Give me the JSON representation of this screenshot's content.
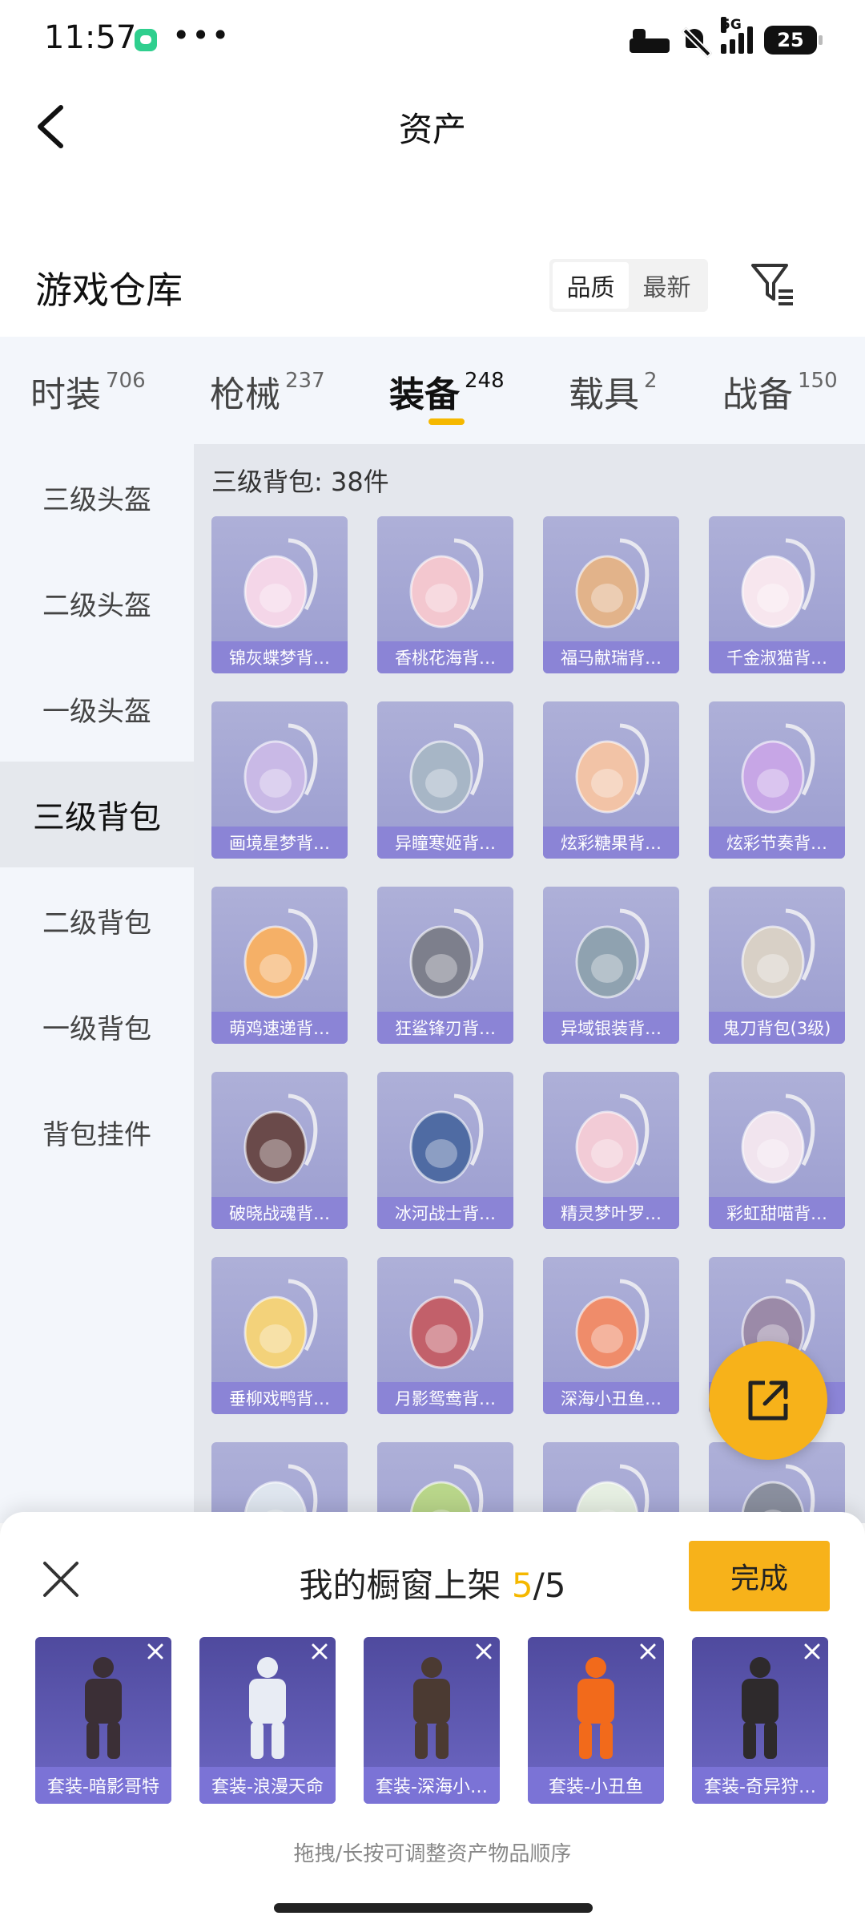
{
  "status_bar": {
    "time": "11:57",
    "more": "•••",
    "network": "5G",
    "battery": "25",
    "icons": [
      "chat-app-icon",
      "bed-icon",
      "mute-icon",
      "signal-icon",
      "battery-icon"
    ]
  },
  "header": {
    "title": "资产",
    "back_icon": "chevron-left-icon"
  },
  "section": {
    "title": "游戏仓库"
  },
  "sort": {
    "options": [
      "品质",
      "最新"
    ],
    "selected": "品质"
  },
  "filter": {
    "icon": "filter-icon"
  },
  "tabs": [
    {
      "label": "时装",
      "count": "706"
    },
    {
      "label": "枪械",
      "count": "237"
    },
    {
      "label": "装备",
      "count": "248"
    },
    {
      "label": "载具",
      "count": "2"
    },
    {
      "label": "战备",
      "count": "150"
    }
  ],
  "active_tab": "装备",
  "sidebar": {
    "items": [
      "三级头盔",
      "二级头盔",
      "一级头盔",
      "三级背包",
      "二级背包",
      "一级背包",
      "背包挂件"
    ],
    "active": "三级背包"
  },
  "main": {
    "heading": "三级背包: 38件",
    "items": [
      "锦灰蝶梦背…",
      "香桃花海背…",
      "福马献瑞背…",
      "千金淑猫背…",
      "画境星梦背…",
      "异瞳寒姬背…",
      "炫彩糖果背…",
      "炫彩节奏背…",
      "萌鸡速递背…",
      "狂鲨锋刃背…",
      "异域银装背…",
      "鬼刀背包(3级)",
      "破晓战魂背…",
      "冰河战士背…",
      "精灵梦叶罗…",
      "彩虹甜喵背…",
      "垂柳戏鸭背…",
      "月影鸳鸯背…",
      "深海小丑鱼…",
      "",
      "",
      "",
      "",
      ""
    ]
  },
  "share_button": {
    "icon": "share-out-icon"
  },
  "sheet": {
    "title": "我的橱窗上架",
    "count_current": "5",
    "count_total": "/5",
    "done_label": "完成",
    "close_icon": "close-icon",
    "items": [
      "套装-暗影哥特",
      "套装-浪漫天命",
      "套装-深海小…",
      "套装-小丑鱼",
      "套装-奇异狩…"
    ],
    "hint": "拖拽/长按可调整资产物品顺序"
  },
  "colors": {
    "accent": "#f7b21a",
    "card": "#9b9dd0",
    "card_label": "#8b84d6",
    "shelf_card": "#5a54ae"
  }
}
